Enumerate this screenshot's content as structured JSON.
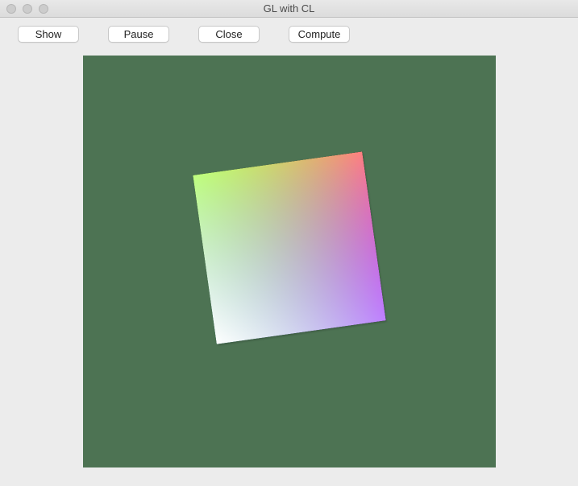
{
  "window": {
    "title": "GL with CL"
  },
  "toolbar": {
    "show_label": "Show",
    "pause_label": "Pause",
    "close_label": "Close",
    "compute_label": "Compute"
  },
  "canvas": {
    "bg_color": "#4d7353",
    "quad_rotation_deg": -8,
    "quad_colors": {
      "top_left": "#00ff00",
      "top_right": "#ff0000",
      "bottom_right": "#0000ff",
      "bottom_left": "#ffffff"
    }
  }
}
